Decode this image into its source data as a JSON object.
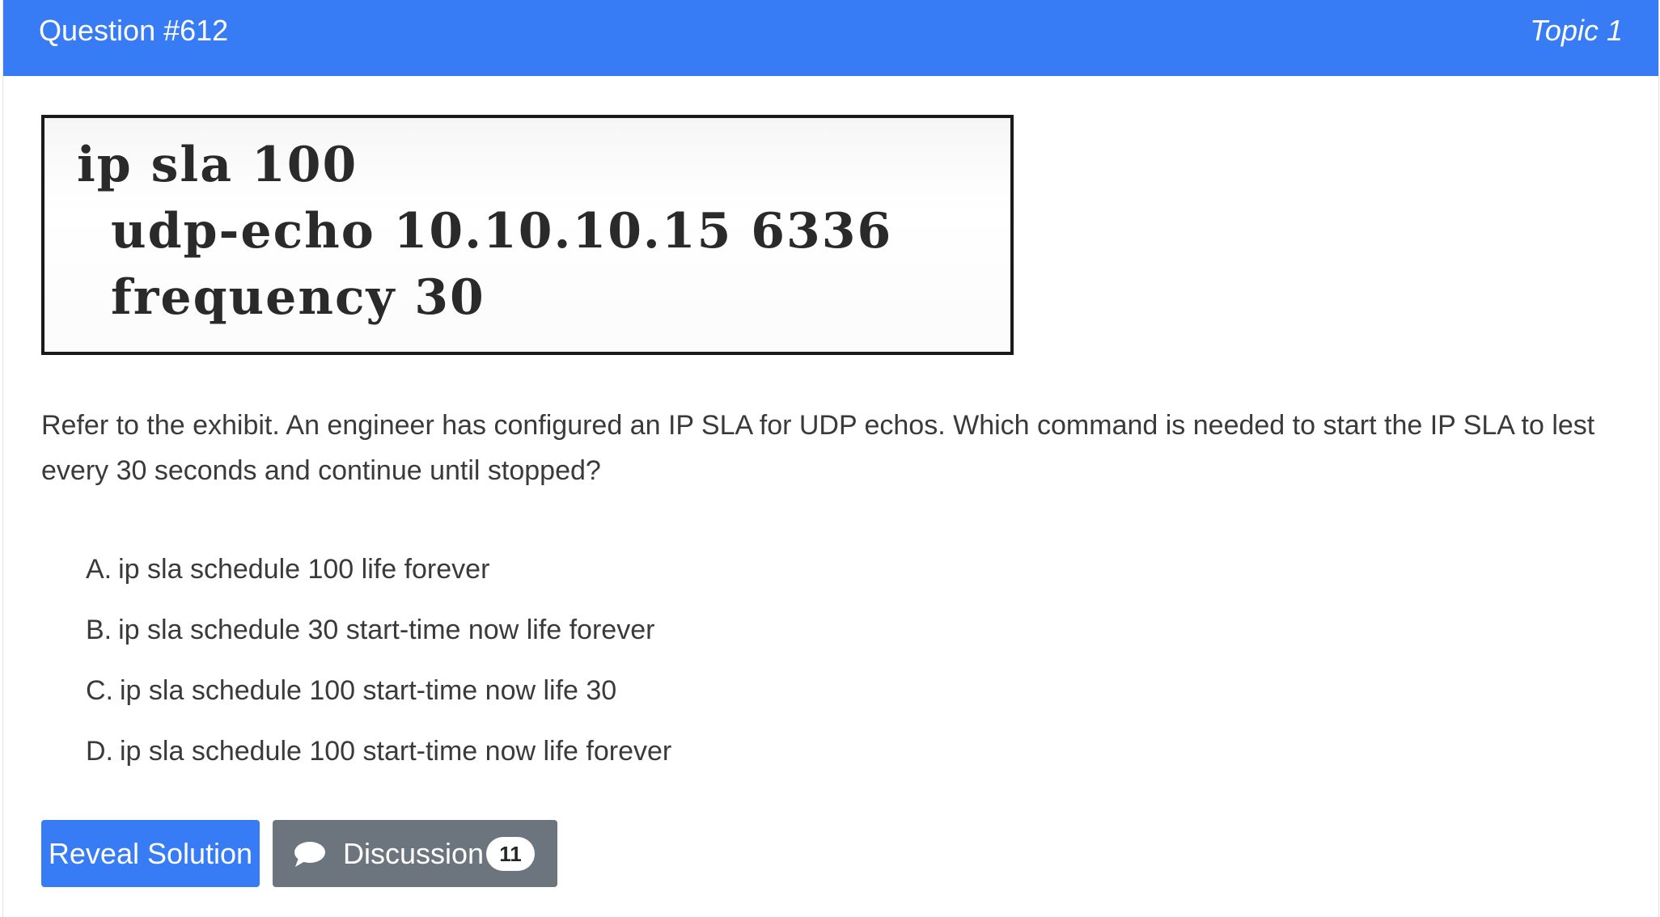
{
  "header": {
    "question_number": "Question #612",
    "topic": "Topic 1"
  },
  "exhibit": {
    "lines": [
      "ip sla 100",
      "udp-echo 10.10.10.15 6336",
      "frequency 30"
    ]
  },
  "question": {
    "text": "Refer to the exhibit. An engineer has configured an IP SLA for UDP echos. Which command is needed to start the IP SLA to lest every 30 seconds and continue until stopped?"
  },
  "choices": [
    {
      "letter": "A.",
      "text": "ip sla schedule 100 life forever"
    },
    {
      "letter": "B.",
      "text": "ip sla schedule 30 start-time now life forever"
    },
    {
      "letter": "C.",
      "text": "ip sla schedule 100 start-time now life 30"
    },
    {
      "letter": "D.",
      "text": "ip sla schedule 100 start-time now life forever"
    }
  ],
  "buttons": {
    "reveal_label": "Reveal Solution",
    "discussion_label": "Discussion",
    "discussion_count": "11"
  },
  "colors": {
    "header_bg": "#377cf5",
    "primary_button": "#377cf5",
    "secondary_button": "#6c757d"
  },
  "icons": {
    "discussion": "chat-bubble-icon"
  }
}
